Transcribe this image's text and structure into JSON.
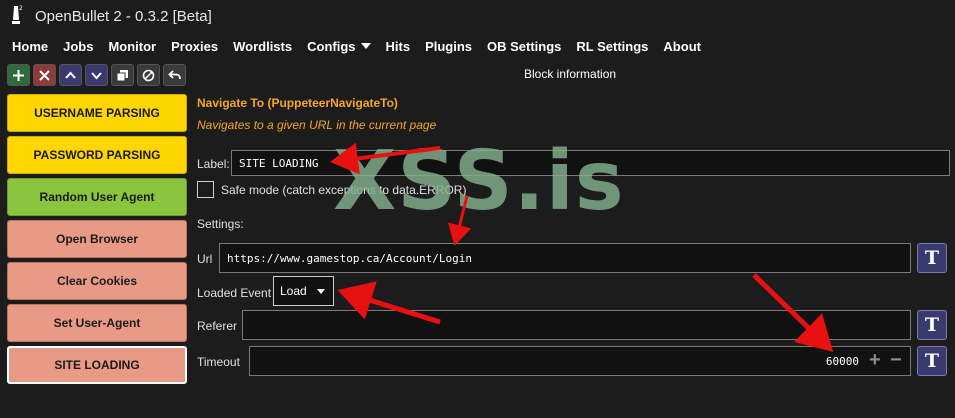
{
  "window": {
    "title": "OpenBullet 2 - 0.3.2 [Beta]"
  },
  "menu": {
    "items": [
      "Home",
      "Jobs",
      "Monitor",
      "Proxies",
      "Wordlists",
      "Configs",
      "Hits",
      "Plugins",
      "OB Settings",
      "RL Settings",
      "About"
    ]
  },
  "blocks": [
    {
      "label": "USERNAME PARSING",
      "color": "yellow"
    },
    {
      "label": "PASSWORD PARSING",
      "color": "yellow"
    },
    {
      "label": "Random User Agent",
      "color": "green"
    },
    {
      "label": "Open Browser",
      "color": "salmon"
    },
    {
      "label": "Clear Cookies",
      "color": "salmon"
    },
    {
      "label": "Set User-Agent",
      "color": "salmon"
    },
    {
      "label": "SITE LOADING",
      "color": "salmon",
      "selected": true
    }
  ],
  "info": {
    "header": "Block information",
    "title": "Navigate To (PuppeteerNavigateTo)",
    "description": "Navigates to a given URL in the current page",
    "label_caption": "Label:",
    "label_value": "SITE LOADING",
    "safe_mode": "Safe mode (catch exceptions to data.ERROR)",
    "settings_caption": "Settings:",
    "url_caption": "Url",
    "url_value": "https://www.gamestop.ca/Account/Login",
    "loaded_event_caption": "Loaded Event",
    "loaded_event_value": "Load",
    "referer_caption": "Referer",
    "referer_value": "",
    "timeout_caption": "Timeout",
    "timeout_value": "60000",
    "t_button": "T",
    "plus": "+",
    "minus": "−"
  },
  "watermark": "XSS.is",
  "colors": {
    "accent_orange": "#f5a623",
    "block_yellow": "#ffd600",
    "block_green": "#8bc53f",
    "block_salmon": "#e99a86",
    "arrow_red": "#e81010"
  }
}
